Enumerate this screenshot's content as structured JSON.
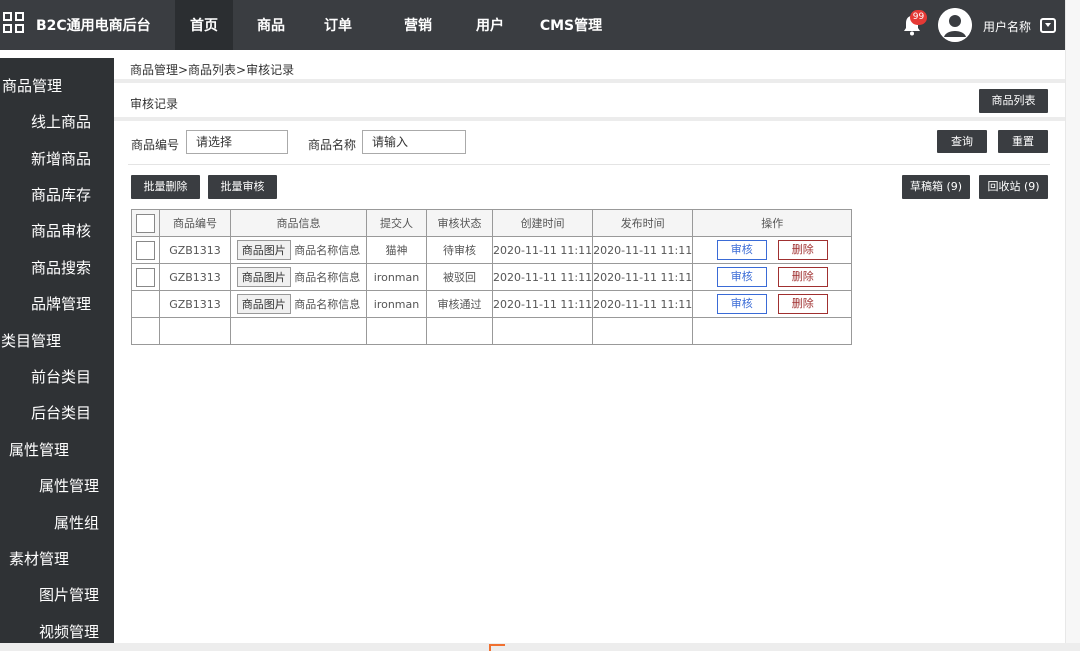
{
  "app": {
    "brand": "B2C通用电商后台",
    "nav": [
      "首页",
      "商品",
      "订单",
      "营销",
      "用户",
      "CMS管理"
    ],
    "notification_count": "99",
    "username": "用户名称"
  },
  "sidebar": {
    "items": [
      "商品管理",
      "线上商品",
      "新增商品",
      "商品库存",
      "商品审核",
      "商品搜索",
      "品牌管理",
      "类目管理",
      "前台类目",
      "后台类目",
      "属性管理",
      "属性管理",
      "属性组",
      "素材管理",
      "图片管理",
      "视频管理"
    ]
  },
  "breadcrumb": "商品管理>商品列表>审核记录",
  "section_title": "审核记录",
  "product_list_button": "商品列表",
  "filters": {
    "code_label": "商品编号",
    "code_placeholder": "请选择",
    "name_label": "商品名称",
    "name_placeholder": "请输入",
    "query_button": "查询",
    "reset_button": "重置"
  },
  "actions": {
    "batch_delete": "批量删除",
    "batch_review": "批量审核",
    "drafts": "草稿箱 (9)",
    "recycle": "回收站 (9)"
  },
  "table": {
    "headers": [
      "商品编号",
      "商品信息",
      "提交人",
      "审核状态",
      "创建时间",
      "发布时间",
      "操作"
    ],
    "rows": [
      {
        "code": "GZB1313",
        "image": "商品图片",
        "name": "商品名称信息",
        "submitter": "猫神",
        "status": "待审核",
        "created": "2020-11-11 11:11",
        "published": "2020-11-11 11:11",
        "review": "审核",
        "delete": "删除"
      },
      {
        "code": "GZB1313",
        "image": "商品图片",
        "name": "商品名称信息",
        "submitter": "ironman",
        "status": "被驳回",
        "created": "2020-11-11 11:11",
        "published": "2020-11-11 11:11",
        "review": "审核",
        "delete": "删除"
      },
      {
        "code": "GZB1313",
        "image": "商品图片",
        "name": "商品名称信息",
        "submitter": "ironman",
        "status": "审核通过",
        "created": "2020-11-11 11:11",
        "published": "2020-11-11 11:11",
        "review": "审核",
        "delete": "删除"
      }
    ]
  }
}
